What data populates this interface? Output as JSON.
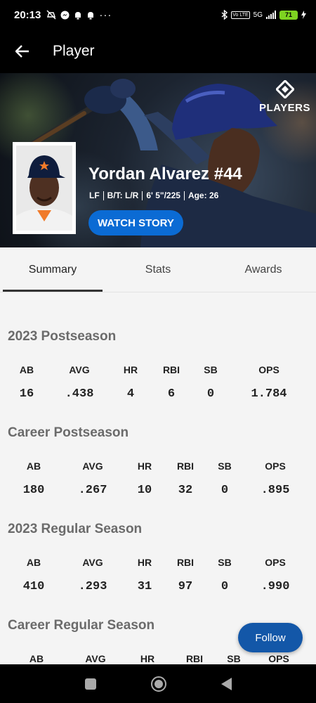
{
  "status_bar": {
    "time": "20:13",
    "signal_label": "5G",
    "lte_label": "Vo LTE",
    "battery_level": "71"
  },
  "app_bar": {
    "title": "Player"
  },
  "hero": {
    "brand": "PLAYERS",
    "player_name": "Yordan Alvarez #44",
    "position": "LF",
    "bats_throws": "B/T: L/R",
    "height_weight": "6' 5\"/225",
    "age": "Age: 26",
    "watch_button": "WATCH STORY"
  },
  "tabs": [
    {
      "label": "Summary",
      "active": true
    },
    {
      "label": "Stats",
      "active": false
    },
    {
      "label": "Awards",
      "active": false
    }
  ],
  "sections": [
    {
      "title": "2023 Postseason",
      "headers": [
        "AB",
        "AVG",
        "HR",
        "RBI",
        "SB",
        "OPS"
      ],
      "values": [
        "16",
        ".438",
        "4",
        "6",
        "0",
        "1.784"
      ]
    },
    {
      "title": "Career Postseason",
      "headers": [
        "AB",
        "AVG",
        "HR",
        "RBI",
        "SB",
        "OPS"
      ],
      "values": [
        "180",
        ".267",
        "10",
        "32",
        "0",
        ".895"
      ]
    },
    {
      "title": "2023 Regular Season",
      "headers": [
        "AB",
        "AVG",
        "HR",
        "RBI",
        "SB",
        "OPS"
      ],
      "values": [
        "410",
        ".293",
        "31",
        "97",
        "0",
        ".990"
      ]
    },
    {
      "title": "Career Regular Season",
      "headers": [
        "AB",
        "AVG",
        "HR",
        "RBI",
        "SB",
        "OPS"
      ],
      "values": []
    }
  ],
  "follow_button": "Follow",
  "colors": {
    "accent_blue": "#0b6bd4",
    "follow_blue": "#1357a8",
    "battery_green": "#7ed321"
  }
}
